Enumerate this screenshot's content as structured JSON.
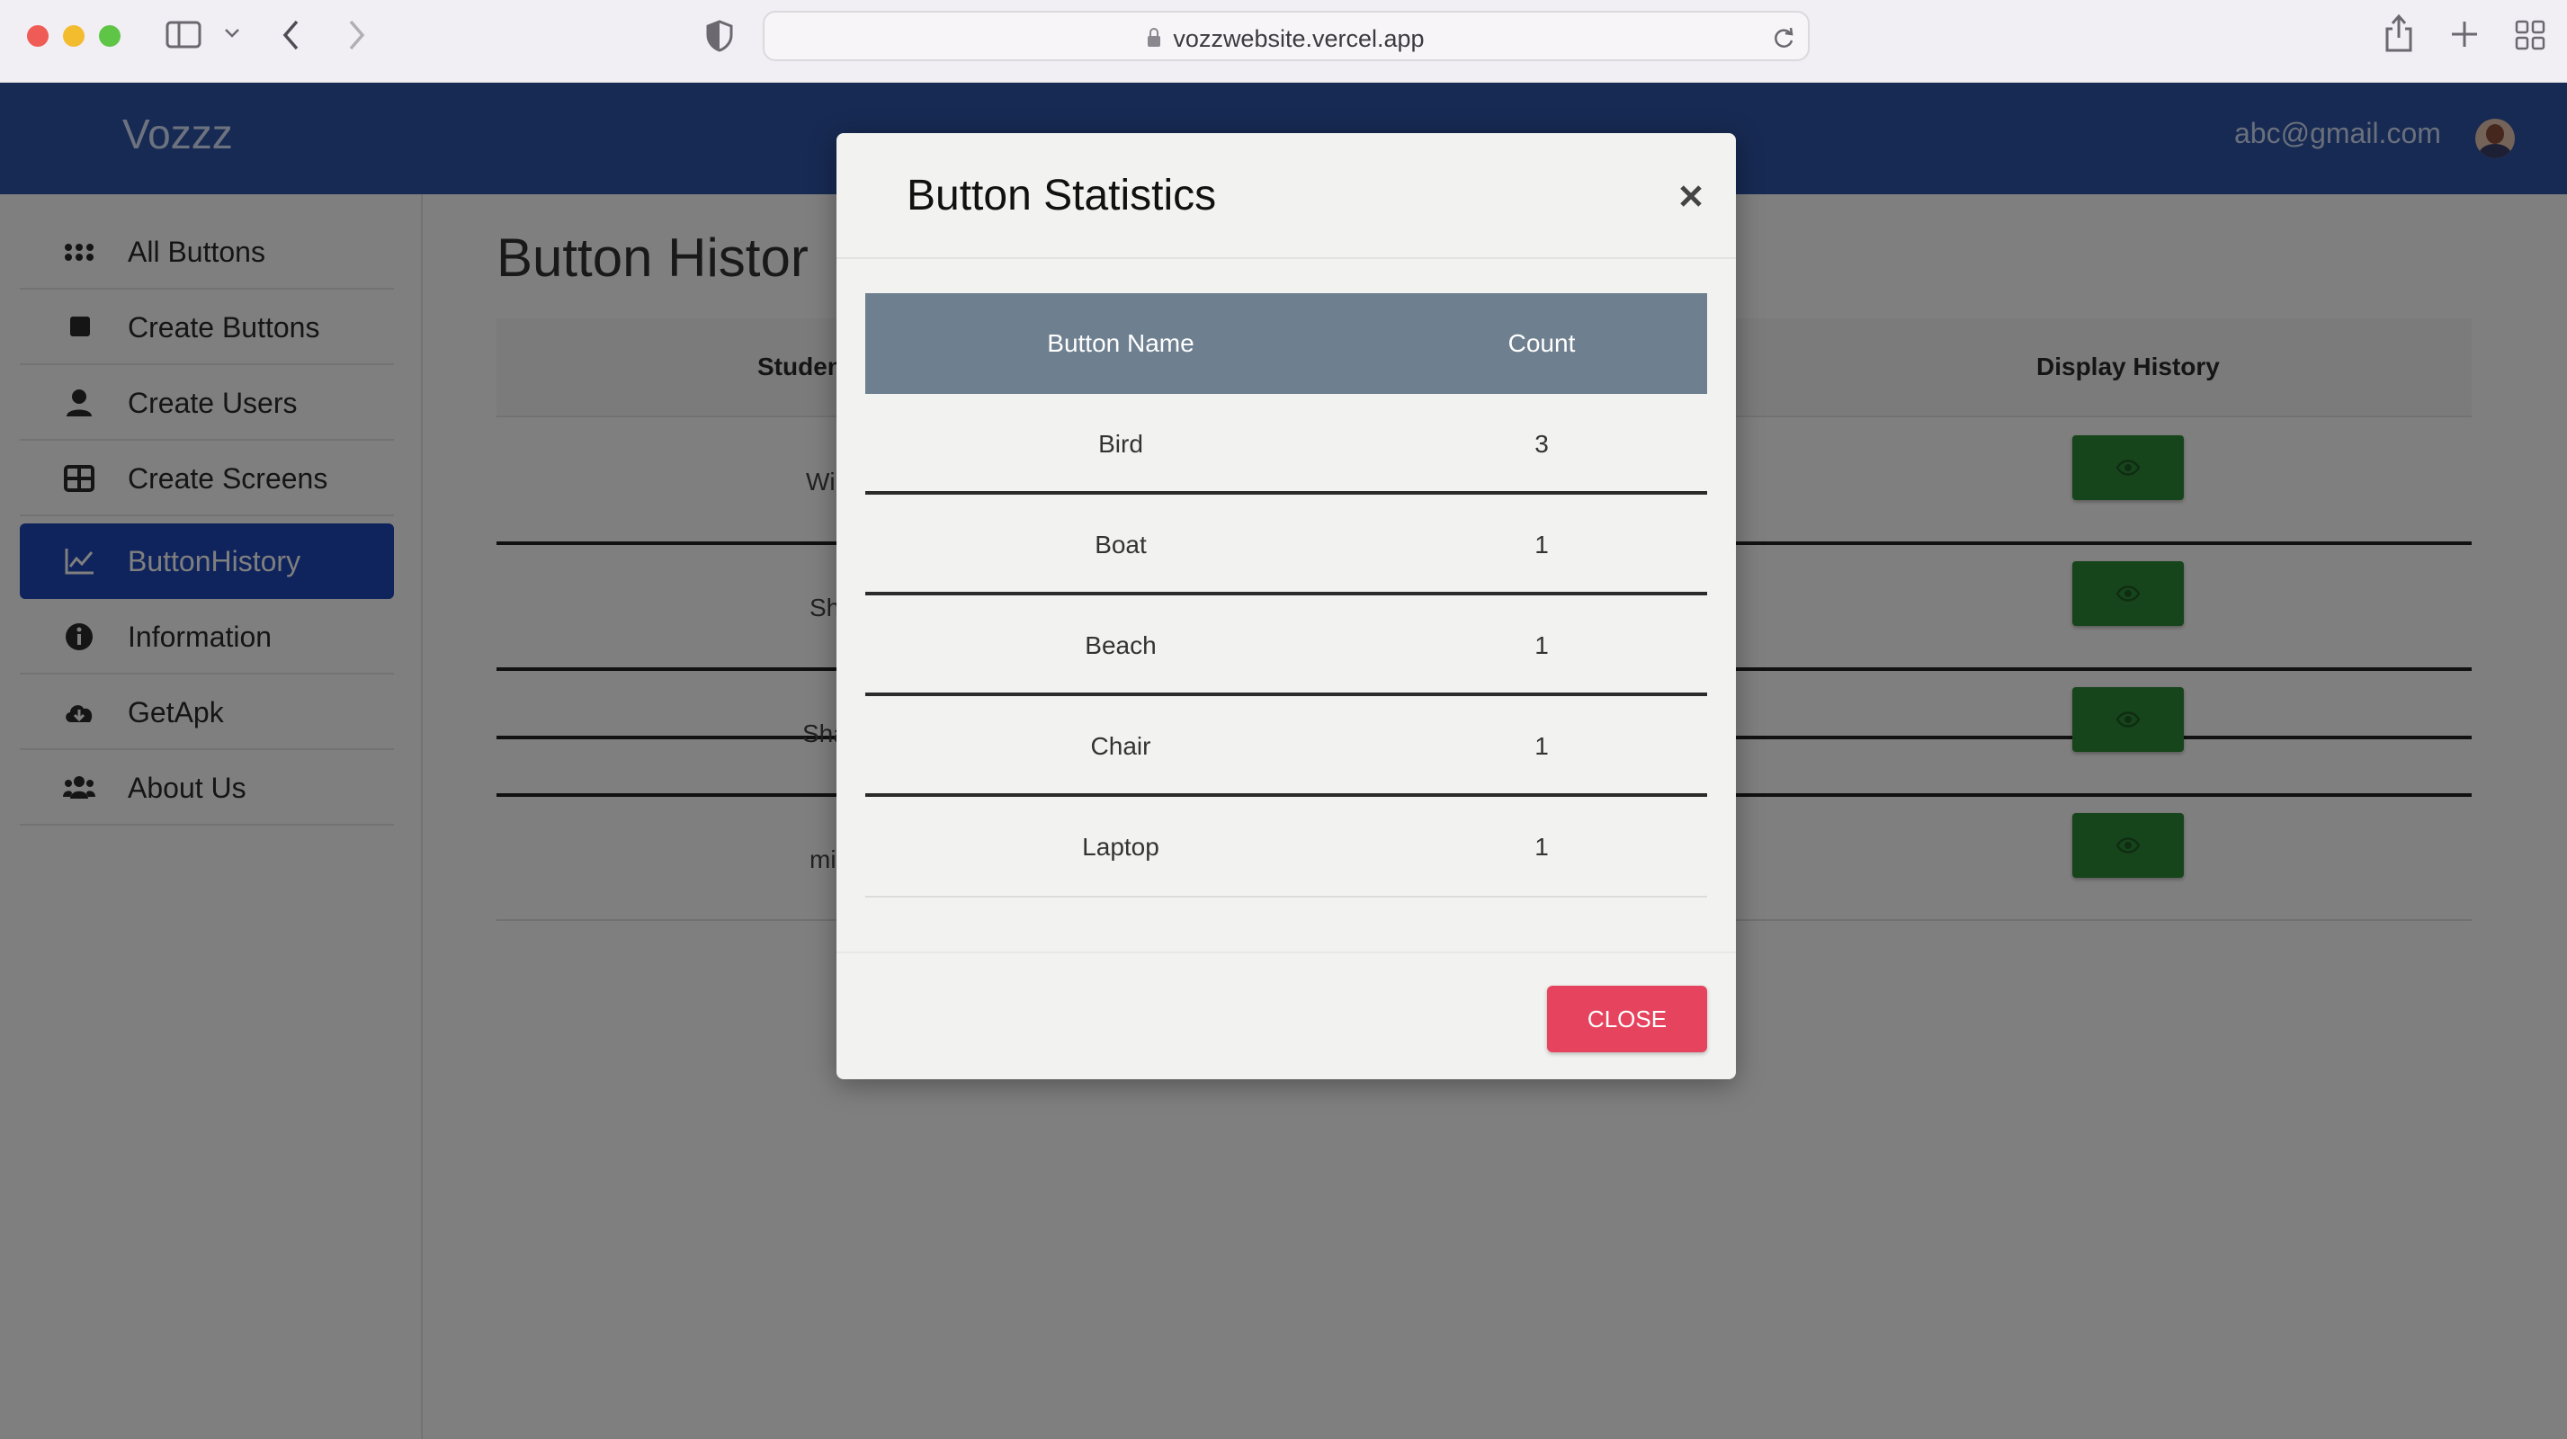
{
  "browser": {
    "url": "vozzwebsite.vercel.app"
  },
  "app": {
    "brand": "Vozzz",
    "user_email": "abc@gmail.com"
  },
  "sidebar": {
    "items": [
      {
        "label": "All Buttons",
        "icon": "grid-dots-icon",
        "active": false
      },
      {
        "label": "Create Buttons",
        "icon": "square-icon",
        "active": false
      },
      {
        "label": "Create Users",
        "icon": "user-icon",
        "active": false
      },
      {
        "label": "Create Screens",
        "icon": "table-icon",
        "active": false
      },
      {
        "label": "ButtonHistory",
        "icon": "line-chart-icon",
        "active": true
      },
      {
        "label": "Information",
        "icon": "info-icon",
        "active": false
      },
      {
        "label": "GetApk",
        "icon": "cloud-download-icon",
        "active": false
      },
      {
        "label": "About Us",
        "icon": "users-icon",
        "active": false
      }
    ]
  },
  "main": {
    "title": "Button Histor",
    "columns": [
      "Studen",
      "Display History"
    ],
    "rows": [
      {
        "student": "Wi"
      },
      {
        "student": "Sh"
      },
      {
        "student": "Sha"
      },
      {
        "student": "mi"
      }
    ]
  },
  "modal": {
    "title": "Button Statistics",
    "close_label": "CLOSE",
    "columns": [
      "Button Name",
      "Count"
    ],
    "rows": [
      {
        "name": "Bird",
        "count": "3"
      },
      {
        "name": "Boat",
        "count": "1"
      },
      {
        "name": "Beach",
        "count": "1"
      },
      {
        "name": "Chair",
        "count": "1"
      },
      {
        "name": "Laptop",
        "count": "1"
      }
    ]
  },
  "colors": {
    "topbar": "#2e55a7",
    "active_nav": "#1f47b8",
    "view_button": "#2f8a36",
    "close_button": "#e6445e",
    "modal_table_header": "#6e7f8f"
  }
}
